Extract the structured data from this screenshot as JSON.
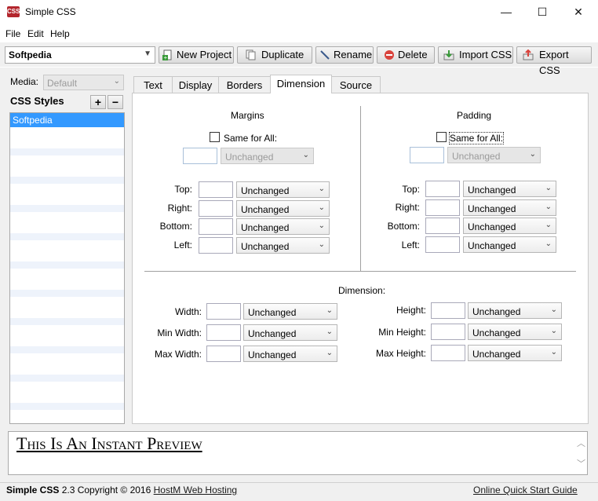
{
  "window": {
    "title": "Simple CSS",
    "minimize": "—",
    "maximize": "☐",
    "close": "✕",
    "icon_text": "CSS"
  },
  "menu": [
    "File",
    "Edit",
    "Help"
  ],
  "toolbar": {
    "project": "Softpedia",
    "buttons": [
      "New Project",
      "Duplicate",
      "Rename",
      "Delete",
      "Import CSS",
      "Export CSS"
    ]
  },
  "left": {
    "media_label": "Media:",
    "media_value": "Default",
    "styles_title": "CSS Styles",
    "add": "+",
    "remove": "−",
    "items": [
      "Softpedia"
    ]
  },
  "tabs": [
    "Text",
    "Display",
    "Borders",
    "Dimension",
    "Source"
  ],
  "active_tab": "Dimension",
  "margins": {
    "title": "Margins",
    "same_label": "Same for All:",
    "all_value": "Unchanged",
    "rows": [
      {
        "label": "Top:",
        "value": "Unchanged"
      },
      {
        "label": "Right:",
        "value": "Unchanged"
      },
      {
        "label": "Bottom:",
        "value": "Unchanged"
      },
      {
        "label": "Left:",
        "value": "Unchanged"
      }
    ]
  },
  "padding": {
    "title": "Padding",
    "same_label": "Same for All:",
    "all_value": "Unchanged",
    "rows": [
      {
        "label": "Top:",
        "value": "Unchanged"
      },
      {
        "label": "Right:",
        "value": "Unchanged"
      },
      {
        "label": "Bottom:",
        "value": "Unchanged"
      },
      {
        "label": "Left:",
        "value": "Unchanged"
      }
    ]
  },
  "dimension": {
    "title": "Dimension:",
    "left_rows": [
      {
        "label": "Width:",
        "value": "Unchanged"
      },
      {
        "label": "Min Width:",
        "value": "Unchanged"
      },
      {
        "label": "Max Width:",
        "value": "Unchanged"
      }
    ],
    "right_rows": [
      {
        "label": "Height:",
        "value": "Unchanged"
      },
      {
        "label": "Min Height:",
        "value": "Unchanged"
      },
      {
        "label": "Max Height:",
        "value": "Unchanged"
      }
    ]
  },
  "preview": {
    "text": "This Is An Instant Preview"
  },
  "status": {
    "app": "Simple CSS",
    "version_text": "2.3 Copyright © 2016",
    "host_link": "HostM Web Hosting",
    "guide_link": "Online Quick Start Guide"
  },
  "colors": {
    "selection": "#3399ff",
    "icon": "#b3262d"
  }
}
